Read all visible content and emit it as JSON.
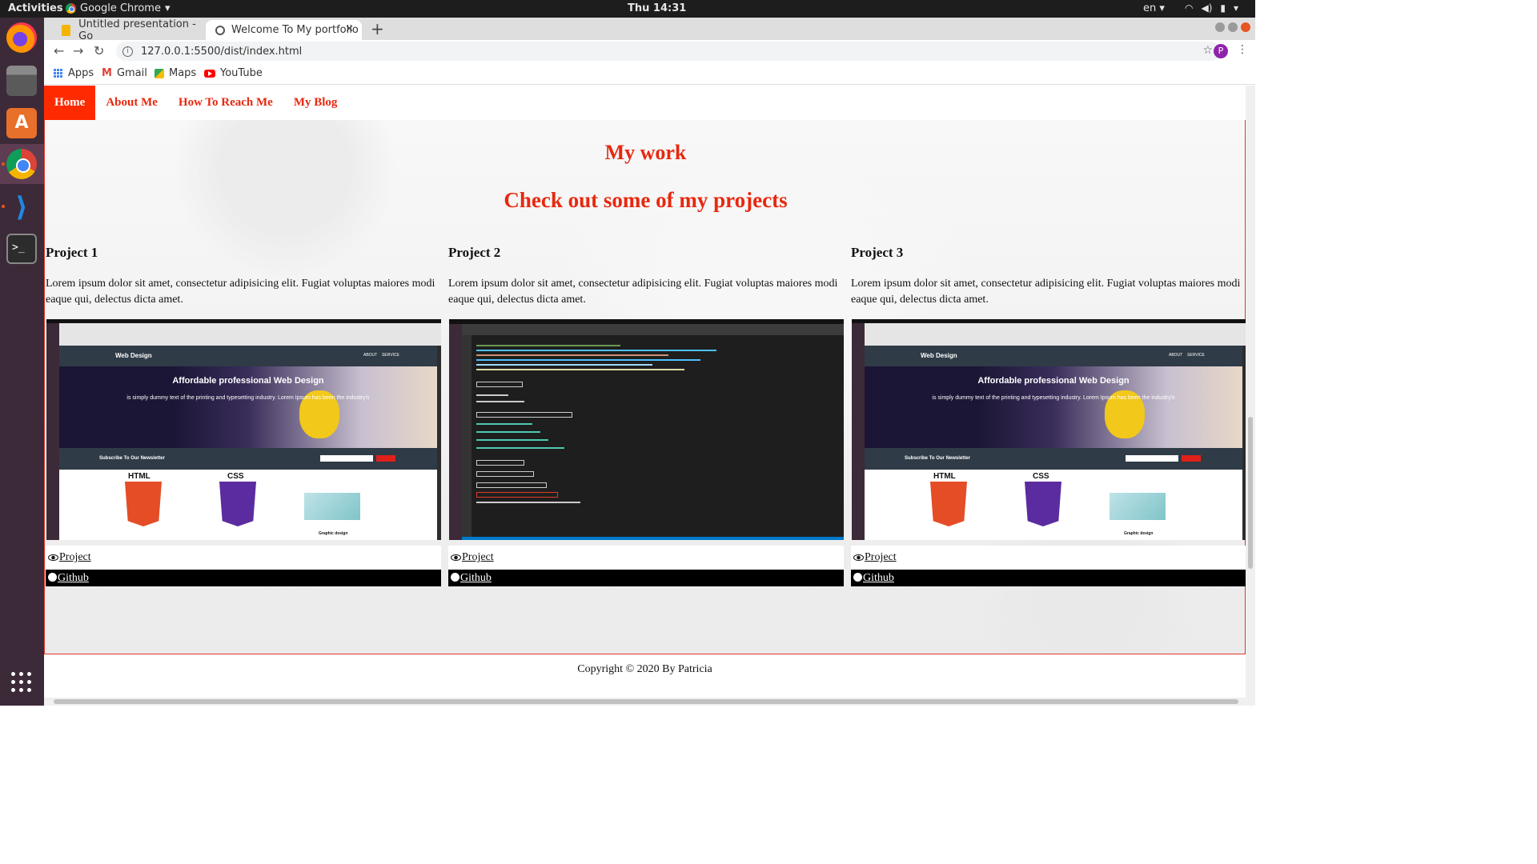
{
  "system": {
    "activities": "Activities",
    "app_menu": "Google Chrome",
    "clock": "Thu 14:31",
    "language": "en"
  },
  "browser": {
    "tabs": [
      {
        "label": "Untitled presentation - Go"
      },
      {
        "label": "Welcome To My portfolio"
      }
    ],
    "url": "127.0.0.1:5500/dist/index.html",
    "profile_initial": "P",
    "bookmarks": [
      {
        "label": "Apps",
        "icon": "apps-grid-icon"
      },
      {
        "label": "Gmail",
        "icon": "gmail-icon"
      },
      {
        "label": "Maps",
        "icon": "maps-icon"
      },
      {
        "label": "YouTube",
        "icon": "youtube-icon"
      }
    ]
  },
  "site": {
    "nav": [
      "Home",
      "About Me",
      "How To Reach Me",
      "My Blog"
    ],
    "heading": "My work",
    "subheading": "Check out some of my projects",
    "projects": [
      {
        "title": "Project 1",
        "description": "Lorem ipsum dolor sit amet, consectetur adipisicing elit. Fugiat voluptas maiores modi eaque qui, delectus dicta amet.",
        "project_link": "Project",
        "github_link": "Github"
      },
      {
        "title": "Project 2",
        "description": "Lorem ipsum dolor sit amet, consectetur adipisicing elit. Fugiat voluptas maiores modi eaque qui, delectus dicta amet.",
        "project_link": "Project",
        "github_link": "Github"
      },
      {
        "title": "Project 3",
        "description": "Lorem ipsum dolor sit amet, consectetur adipisicing elit. Fugiat voluptas maiores modi eaque qui, delectus dicta amet.",
        "project_link": "Project",
        "github_link": "Github"
      }
    ],
    "thumb_webdesign": {
      "brand": "Web Design",
      "nav": [
        "ABOUT",
        "SERVICE"
      ],
      "title": "Affordable professional Web Design",
      "subtitle": "is simply dummy text of the printing and typesetting industry. Lorem Ipsum has been the industry's",
      "newsletter": "Subscribe To Our Newsletter",
      "html_label": "HTML",
      "css_label": "CSS",
      "graphic_label": "Graphic design"
    },
    "footer": "Copyright © 2020 By Patricia"
  },
  "colors": {
    "accent": "#e8280f",
    "nav_active_bg": "#ff2a00",
    "github_bar": "#000000"
  }
}
